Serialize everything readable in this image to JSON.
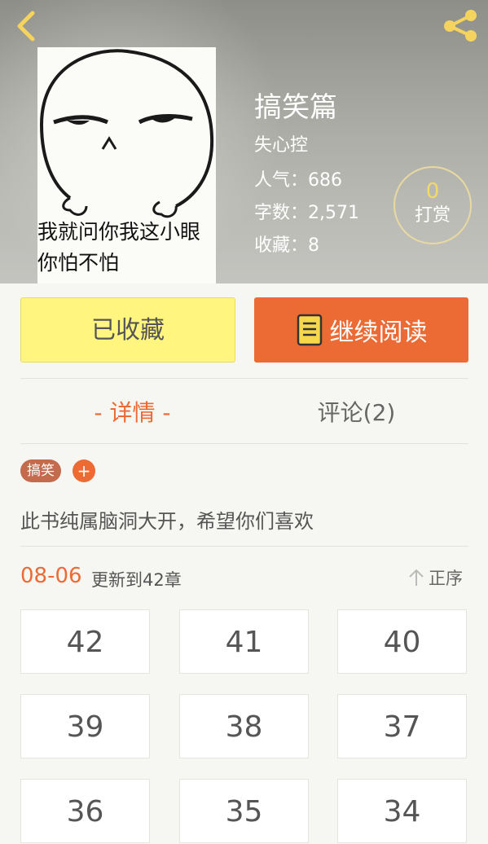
{
  "book": {
    "title": "搞笑篇",
    "author": "失心控",
    "cover_text": "我就问你我这小眼\n你怕不怕",
    "stats": {
      "popularity": "人气：686",
      "word_count": "字数：2,571",
      "favorites": "收藏：8"
    }
  },
  "tip": {
    "count": "0",
    "label": "打赏"
  },
  "actions": {
    "favorited_label": "已收藏",
    "continue_label": "继续阅读"
  },
  "tabs": {
    "detail": "- 详情 -",
    "comments": "评论(2)"
  },
  "tags": {
    "items": [
      "搞笑"
    ],
    "add_label": "+"
  },
  "description": "此书纯属脑洞大开，希望你们喜欢",
  "update": {
    "date": "08-06",
    "text": "更新到42章",
    "sort_label": "正序"
  },
  "chapters": [
    "42",
    "41",
    "40",
    "39",
    "38",
    "37",
    "36",
    "35",
    "34"
  ],
  "colors": {
    "accent": "#ec6a33",
    "favorite_yellow": "#fff57f",
    "tip_gold": "#f3d96a"
  },
  "icons": [
    "back-arrow-icon",
    "share-icon",
    "book-icon",
    "sort-arrow-icon"
  ]
}
